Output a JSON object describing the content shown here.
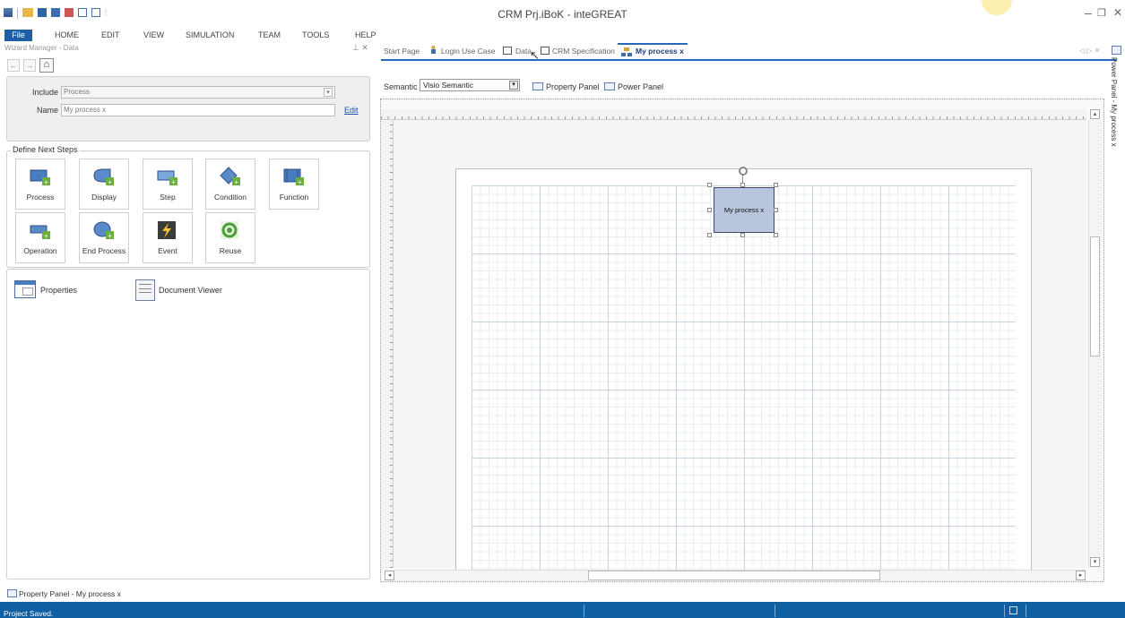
{
  "window": {
    "title": "CRM Prj.iBoK - inteGREAT"
  },
  "ribbon": {
    "tabs": [
      "File",
      "HOME",
      "EDIT",
      "VIEW",
      "SIMULATION",
      "TEAM",
      "TOOLS",
      "HELP"
    ]
  },
  "wizard": {
    "title": "Wizard Manager - Data",
    "include_label": "Include",
    "include_value": "Process",
    "name_label": "Name",
    "name_value": "My process x",
    "edit_label": "Edit"
  },
  "steps": {
    "title": "Define Next Steps",
    "items": [
      {
        "label": "Process",
        "icon": "process-icon"
      },
      {
        "label": "Display",
        "icon": "display-icon"
      },
      {
        "label": "Step",
        "icon": "step-icon"
      },
      {
        "label": "Condition",
        "icon": "condition-icon"
      },
      {
        "label": "Function",
        "icon": "function-icon"
      },
      {
        "label": "Operation",
        "icon": "operation-icon"
      },
      {
        "label": "End Process",
        "icon": "end-process-icon"
      },
      {
        "label": "Event",
        "icon": "event-icon"
      },
      {
        "label": "Reuse",
        "icon": "reuse-icon"
      }
    ]
  },
  "tools": {
    "properties_label": "Properties",
    "document_viewer_label": "Document Viewer"
  },
  "doc_tabs": {
    "items": [
      "Start Page",
      "Login Use Case",
      "Data",
      "CRM Specification",
      "My process x"
    ],
    "active": "My process x"
  },
  "toolbar": {
    "semantic_label": "Semantic",
    "semantic_value": "Visio Semantic",
    "property_panel_label": "Property Panel",
    "power_panel_label": "Power Panel"
  },
  "canvas": {
    "shape_label": "My process x"
  },
  "bottom": {
    "property_panel_tab": "Property Panel - My process x"
  },
  "side_panel": {
    "label": "Power Panel - My process x"
  },
  "status": {
    "text": "Project Saved."
  },
  "colors": {
    "accent": "#1f5fa8",
    "statusbar": "#0f5fa3",
    "shape_fill": "#b8c5dc"
  }
}
